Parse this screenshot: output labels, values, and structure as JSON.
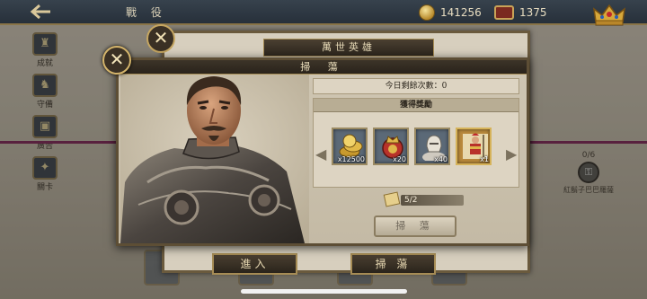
{
  "topbar": {
    "back_icon": "back-arrow-icon",
    "title": "戰 役",
    "coins": "141256",
    "chest_value": "1375"
  },
  "left_menu": [
    {
      "icon": "trophy-icon",
      "glyph": "♜",
      "label": "成就"
    },
    {
      "icon": "knight-icon",
      "glyph": "♞",
      "label": "守備"
    },
    {
      "icon": "film-icon",
      "glyph": "▣",
      "label": "廣告"
    },
    {
      "icon": "quest-icon",
      "glyph": "✦",
      "label": "關卡"
    }
  ],
  "bg_node": {
    "count": "0/6",
    "name": "紅鬍子巴巴羅薩"
  },
  "back_panel": {
    "title": "萬世英雄",
    "enter_label": "進入",
    "sweep_label": "掃 蕩"
  },
  "modal": {
    "title": "掃 蕩",
    "remaining": "今日剩餘次數：0",
    "rewards_header": "獲得獎勵",
    "rewards": [
      {
        "icon": "gold-coins-icon",
        "qty": "x12500"
      },
      {
        "icon": "royal-seal-icon",
        "qty": "x20"
      },
      {
        "icon": "knight-bust-icon",
        "qty": "x40"
      },
      {
        "icon": "soldier-card-icon",
        "qty": "x1"
      }
    ],
    "tickets": "5/2",
    "sweep_button": "掃 蕩"
  },
  "colors": {
    "accent": "#a68c55",
    "topbar": "#2f3943",
    "magenta": "#7d2a58"
  }
}
